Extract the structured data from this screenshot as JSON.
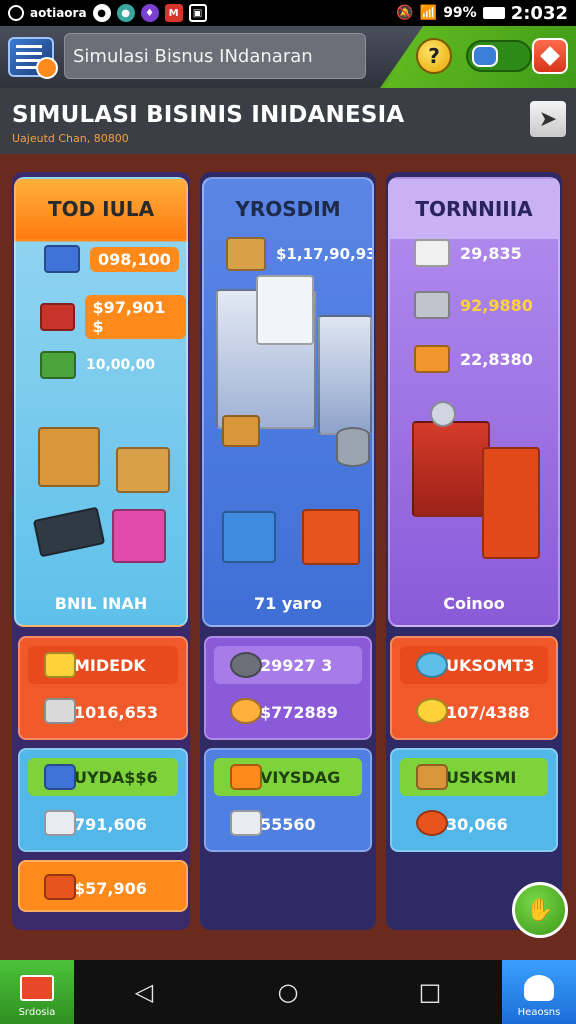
{
  "status_bar": {
    "app_name": "aotiaora",
    "battery": "99%",
    "time": "2:032"
  },
  "app_bar": {
    "search_value": "Simulasi Bisnus INdanaran",
    "help_label": "?"
  },
  "header": {
    "title": "SIMULASI BISINIS INIDANESIA",
    "subtitle": "Uajeutd Chan, 80800"
  },
  "columns": [
    {
      "title": "TOD IULA",
      "color": "#ff8a1c",
      "rows": [
        {
          "value": "098,100"
        },
        {
          "value": "$97,901 $"
        },
        {
          "value": "10,00,00"
        }
      ],
      "footer": "BNIL INAH",
      "stats": [
        {
          "label": "MIDEDK",
          "value": "1016,653"
        },
        {
          "label": "UYDA$$6",
          "value": "791,606"
        },
        {
          "label": "",
          "value": "$57,906"
        }
      ]
    },
    {
      "title": "YROSDIM",
      "color": "#3f6fd6",
      "rows": [
        {
          "value": "$1,17,90,93"
        }
      ],
      "footer": "71 yaro",
      "stats": [
        {
          "label": "29927 3",
          "value": "$772889"
        },
        {
          "label": "VIYSDAG",
          "value": "55560"
        }
      ]
    },
    {
      "title": "TORNNIIIA",
      "color": "#8a5ad8",
      "rows": [
        {
          "value": "29,835"
        },
        {
          "value": "92,9880"
        },
        {
          "value": "22,8380"
        }
      ],
      "footer": "Coinoo",
      "stats": [
        {
          "label": "UKSOMT3",
          "value": "107/4388"
        },
        {
          "label": "USKSMI",
          "value": "30,066"
        }
      ]
    }
  ],
  "nav": {
    "store_label": "Srdosia",
    "home_label": "Heaosns"
  },
  "icons": [
    "settings-icon",
    "help-icon",
    "toggle-icon",
    "share-icon",
    "next-arrow-icon",
    "back-icon",
    "home-icon",
    "recent-apps-icon"
  ]
}
